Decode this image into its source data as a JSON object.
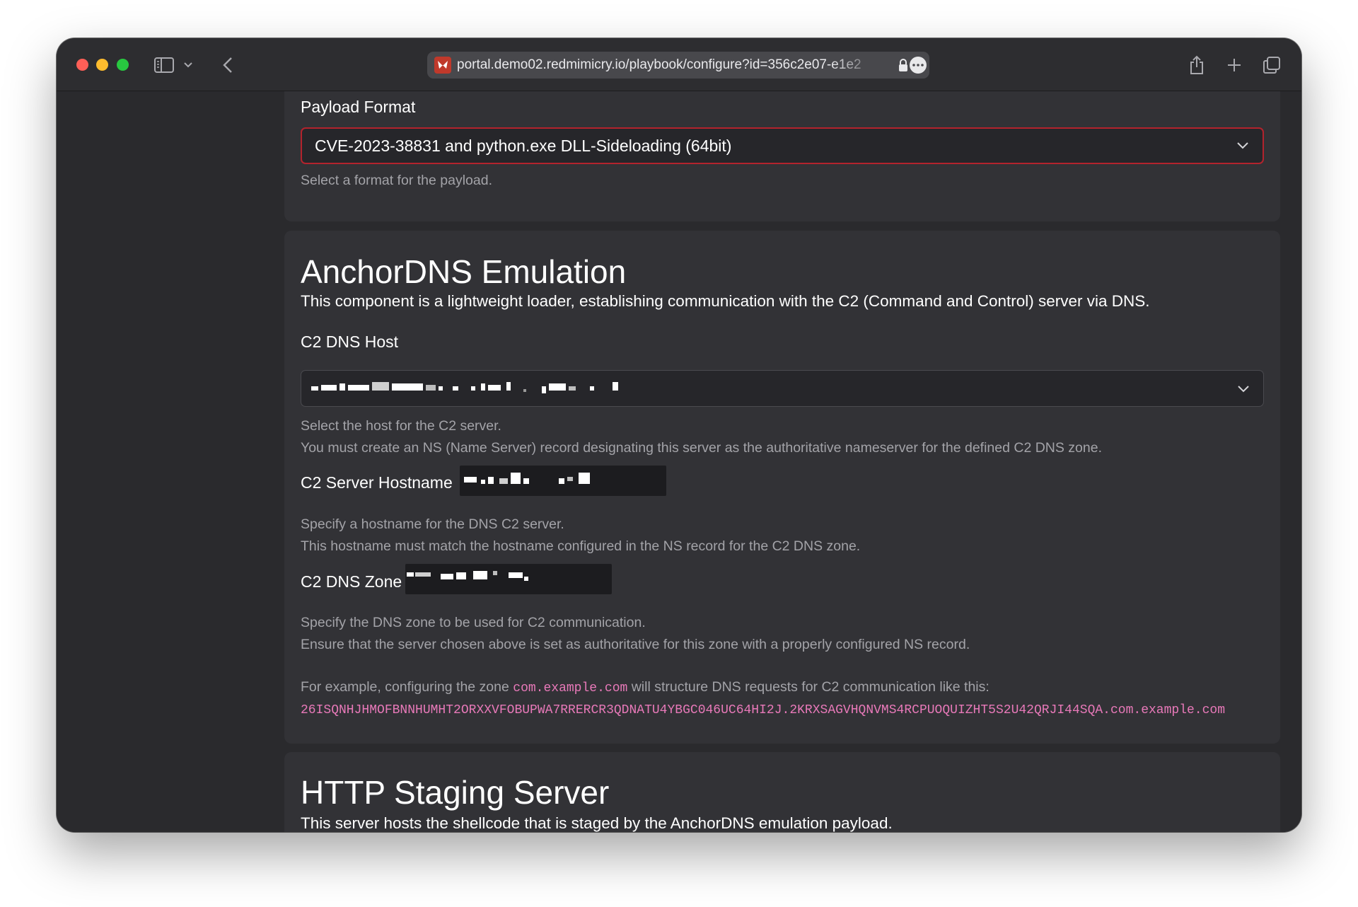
{
  "browser": {
    "url": "portal.demo02.redmimicry.io/playbook/configure?id=356c2e07-e1e2",
    "colors": {
      "accent": "#e879b9",
      "error_border": "#b3232d",
      "traffic_red": "#fe5f57",
      "traffic_yellow": "#febc2e",
      "traffic_green": "#28c840"
    }
  },
  "payload": {
    "label": "Payload Format",
    "selected": "CVE-2023-38831 and python.exe DLL-Sideloading (64bit)",
    "help": "Select a format for the payload."
  },
  "anchor": {
    "title": "AnchorDNS Emulation",
    "description": "This component is a lightweight loader, establishing communication with the C2 (Command and Control) server via DNS.",
    "dns_host": {
      "label": "C2 DNS Host",
      "help1": "Select the host for the C2 server.",
      "help2": "You must create an NS (Name Server) record designating this server as the authoritative nameserver for the defined C2 DNS zone."
    },
    "hostname": {
      "label": "C2 Server Hostname",
      "help1": "Specify a hostname for the DNS C2 server.",
      "help2": "This hostname must match the hostname configured in the NS record for the C2 DNS zone."
    },
    "zone": {
      "label": "C2 DNS Zone",
      "help1": "Specify the DNS zone to be used for C2 communication.",
      "help2": "Ensure that the server chosen above is set as authoritative for this zone with a properly configured NS record."
    },
    "example": {
      "prefix": "For example, configuring the zone",
      "zone_code": "com.example.com",
      "suffix": "will structure DNS requests for C2 communication like this:",
      "request": "26ISQNHJHMOFBNNHUMHT2ORXXVFOBUPWA7RRERCR3QDNATU4YBGC046UC64HI2J.2KRXSAGVHQNVMS4RCPUOQUIZHT5S2U42QRJI44SQA.com.example.com"
    }
  },
  "http": {
    "title": "HTTP Staging Server",
    "description": "This server hosts the shellcode that is staged by the AnchorDNS emulation payload."
  }
}
